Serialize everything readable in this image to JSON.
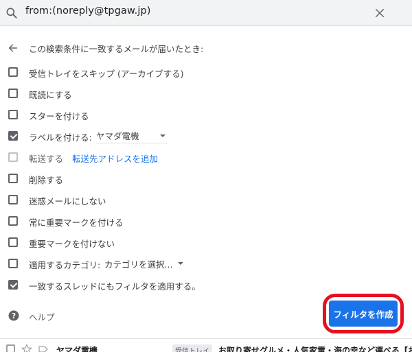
{
  "search": {
    "query": "from:(noreply@tpgaw.jp)",
    "icon": "search-icon",
    "close_icon": "close-icon"
  },
  "filter": {
    "header": "この検索条件に一致するメールが届いたとき:",
    "options": [
      {
        "label": "受信トレイをスキップ (アーカイブする)",
        "checked": false
      },
      {
        "label": "既読にする",
        "checked": false
      },
      {
        "label": "スターを付ける",
        "checked": false
      },
      {
        "label": "ラベルを付ける:",
        "checked": true,
        "select_value": "ヤマダ電機"
      },
      {
        "label": "転送する",
        "checked": false,
        "disabled": true,
        "link": "転送先アドレスを追加"
      },
      {
        "label": "削除する",
        "checked": false
      },
      {
        "label": "迷惑メールにしない",
        "checked": false
      },
      {
        "label": "常に重要マークを付ける",
        "checked": false
      },
      {
        "label": "重要マークを付けない",
        "checked": false
      },
      {
        "label": "適用するカテゴリ:",
        "checked": false,
        "select_value": "カテゴリを選択..."
      },
      {
        "label": "一致するスレッドにもフィルタを適用する。",
        "checked": true
      }
    ],
    "help_label": "ヘルプ",
    "create_button": "フィルタを作成",
    "highlight_color": "#e8101f",
    "accent_color": "#1a73e8"
  },
  "mail_row": {
    "sender": "ヤマダ電機",
    "badge": "受信トレイ",
    "subject": "お取り寄せグルメ・人気家電・海の幸など選べる【お"
  }
}
